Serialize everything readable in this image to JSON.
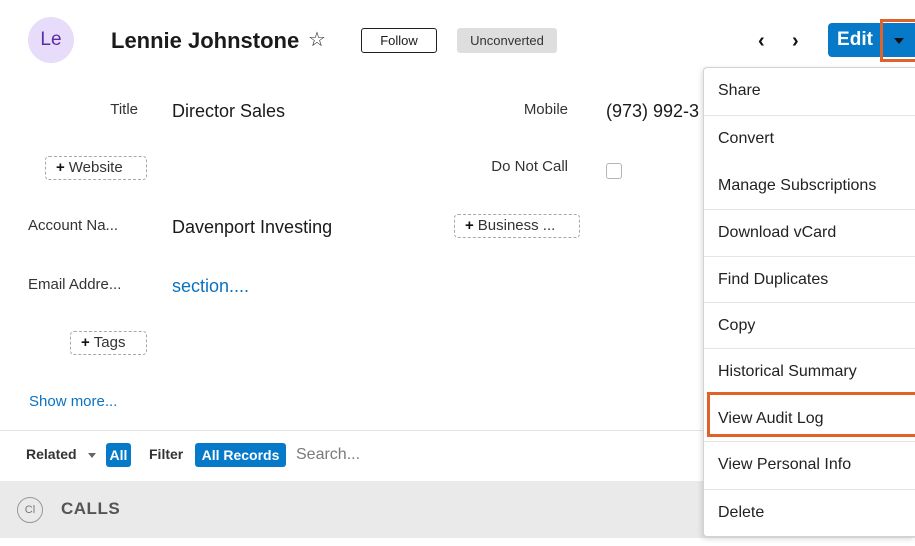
{
  "header": {
    "avatar_initials": "Le",
    "record_name": "Lennie Johnstone",
    "star_icon": "star-outline-icon",
    "follow_label": "Follow",
    "status_badge": "Unconverted",
    "prev_glyph": "‹",
    "next_glyph": "›",
    "edit_label": "Edit",
    "caret_icon": "caret-down-icon"
  },
  "fields": {
    "title_label": "Title",
    "title_value": "Director Sales",
    "mobile_label": "Mobile",
    "mobile_value": "(973) 992-3",
    "website_add": "Website",
    "do_not_call_label": "Do Not Call",
    "account_label": "Account Na...",
    "account_value": "Davenport Investing",
    "business_add": "Business ...",
    "email_label": "Email Addre...",
    "email_value": "section....",
    "tags_add": "Tags",
    "show_more": "Show more..."
  },
  "subpanel": {
    "related_label": "Related",
    "all_chip": "All",
    "filter_label": "Filter",
    "all_records_chip": "All Records",
    "search_placeholder": "Search...",
    "calls_icon_text": "Cl",
    "calls_title": "CALLS"
  },
  "menu": {
    "items": [
      "Share",
      "Convert",
      "Manage Subscriptions",
      "Download vCard",
      "Find Duplicates",
      "Copy",
      "Historical Summary",
      "View Audit Log",
      "View Personal Info",
      "Delete"
    ],
    "highlighted_item": "View Audit Log"
  },
  "colors": {
    "primary": "#0679c8",
    "highlight": "#e0622a",
    "avatar_bg": "#e7dcf9",
    "link": "#0b72c2"
  }
}
